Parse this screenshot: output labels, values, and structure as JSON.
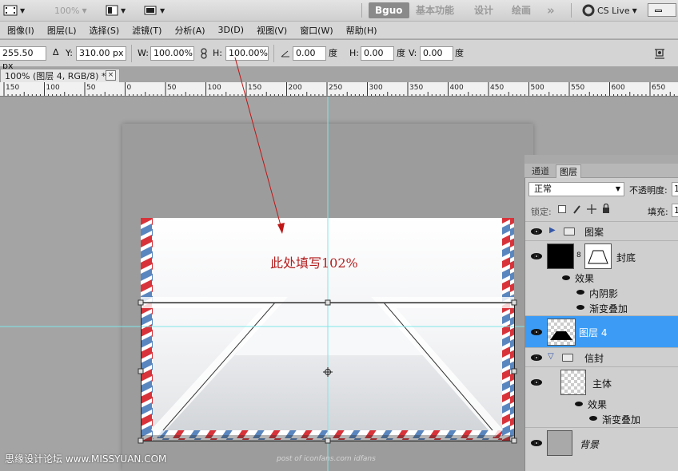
{
  "appbar": {
    "zoom": "100%",
    "workspaces": [
      "Bguo",
      "基本功能",
      "设计",
      "绘画"
    ],
    "more": "»",
    "cs_live": "CS Live"
  },
  "menu": [
    "图像(I)",
    "图层(L)",
    "选择(S)",
    "滤镜(T)",
    "分析(A)",
    "3D(D)",
    "视图(V)",
    "窗口(W)",
    "帮助(H)"
  ],
  "options": {
    "x_value": "255.50 px",
    "y_label": "Y:",
    "y_value": "310.00 px",
    "w_label": "W:",
    "w_value": "100.00%",
    "h_label": "H:",
    "h_value": "100.00%",
    "angle_value": "0.00",
    "deg": "度",
    "hskew_label": "H:",
    "hskew_value": "0.00",
    "vskew_label": "V:",
    "vskew_value": "0.00"
  },
  "document": {
    "tab_title": "100% (图层 4, RGB/8) *",
    "close": "×"
  },
  "ruler": {
    "labels": [
      "150",
      "100",
      "50",
      "0",
      "50",
      "100",
      "150",
      "200",
      "250",
      "300",
      "350",
      "400",
      "450",
      "500",
      "550",
      "600",
      "650"
    ]
  },
  "annotation": {
    "text": "此处填写102%",
    "color": "#b41e1e"
  },
  "watermark": {
    "left": "思缘设计论坛  www.MISSYUAN.COM",
    "center": "post of iconfans.com  idfans"
  },
  "layers_panel": {
    "tabs": [
      "通道",
      "图层"
    ],
    "blend_mode": "正常",
    "opacity_label": "不透明度:",
    "opacity_value": "1",
    "lock_label": "锁定:",
    "fill_label": "填充:",
    "fill_value": "1",
    "layers": [
      {
        "name": "图案",
        "kind": "group-collapsed"
      },
      {
        "name": "封底",
        "kind": "layer-with-mask"
      },
      {
        "name": "效果",
        "kind": "effects-header"
      },
      {
        "name": "内阴影",
        "kind": "effect"
      },
      {
        "name": "渐变叠加",
        "kind": "effect"
      },
      {
        "name": "图层 4",
        "kind": "layer-selected"
      },
      {
        "name": "信封",
        "kind": "group-expanded"
      },
      {
        "name": "主体",
        "kind": "layer"
      },
      {
        "name": "效果",
        "kind": "effects-header"
      },
      {
        "name": "渐变叠加",
        "kind": "effect"
      },
      {
        "name": "背景",
        "kind": "background"
      }
    ],
    "selected_color": "#3c9cf5"
  },
  "colors": {
    "stripe_red": "#d8333a",
    "stripe_blue": "#5a86bf",
    "guide": "#7fe6ea",
    "arrow": "#c01616"
  }
}
